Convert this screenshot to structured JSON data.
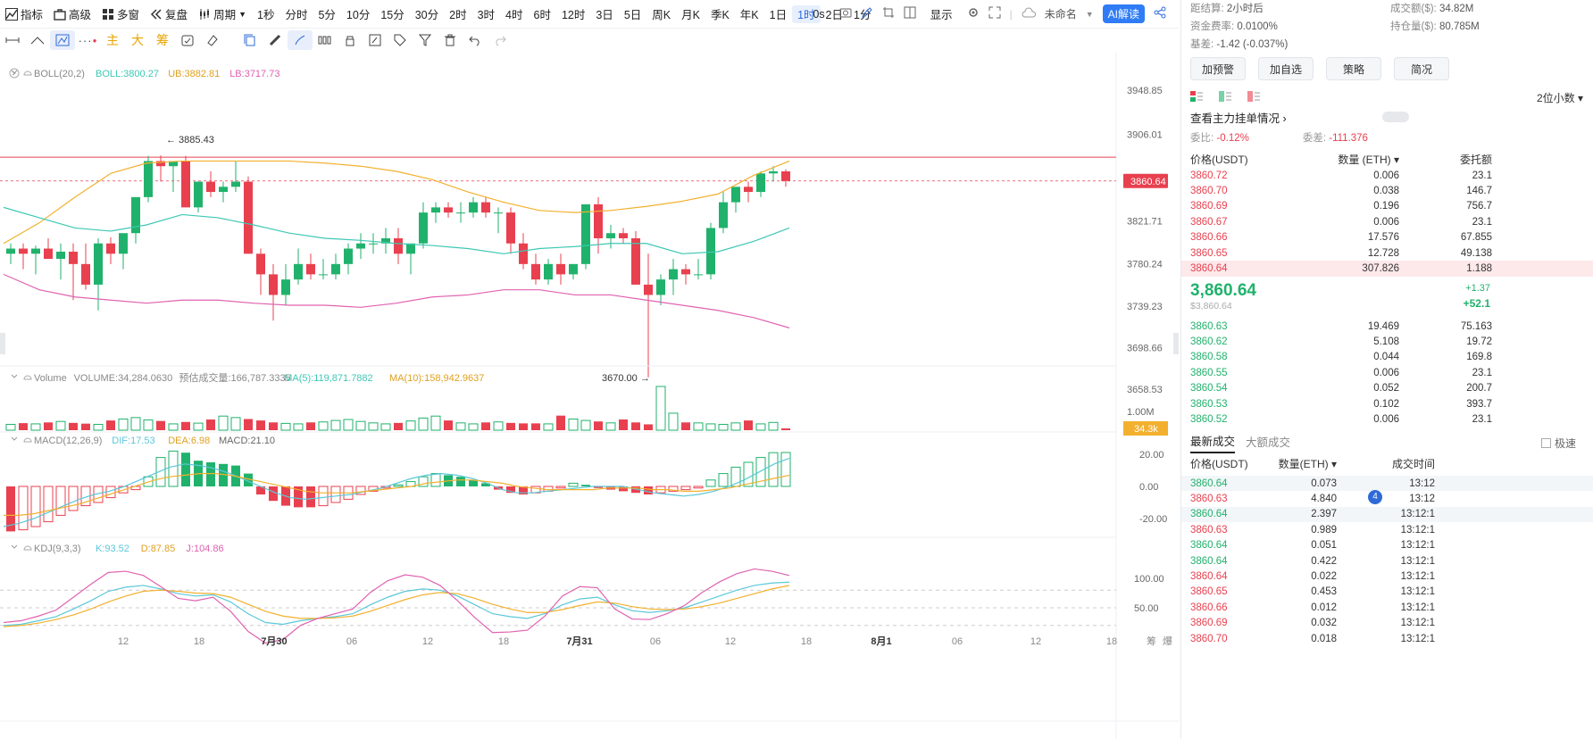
{
  "topbar": {
    "left": [
      "指标",
      "高级",
      "多窗",
      "复盘",
      "周期"
    ],
    "periods": [
      "1秒",
      "分时",
      "5分",
      "10分",
      "15分",
      "30分",
      "2时",
      "3时",
      "4时",
      "6时",
      "12时",
      "3日",
      "5日",
      "周K",
      "月K",
      "季K",
      "年K",
      "1日",
      "1时",
      "2日",
      "1分"
    ],
    "active_period": "1时",
    "right": {
      "countdown": "0s",
      "display": "显示",
      "unnamed": "未命名",
      "ai": "AI解读"
    }
  },
  "toolbar": {
    "text_tools": [
      "主",
      "大",
      "筹"
    ]
  },
  "legends": {
    "boll": {
      "name": "BOLL(20,2)",
      "boll": "BOLL:3800.27",
      "ub": "UB:3882.81",
      "lb": "LB:3717.73"
    },
    "volume": {
      "name": "Volume",
      "vol": "VOLUME:34,284.0630",
      "est": "预估成交量:166,787.3335",
      "ma5": "MA(5):119,871.7882",
      "ma10": "MA(10):158,942.9637"
    },
    "macd": {
      "name": "MACD(12,26,9)",
      "dif": "DIF:17.53",
      "dea": "DEA:6.98",
      "macd": "MACD:21.10"
    },
    "kdj": {
      "name": "KDJ(9,3,3)",
      "k": "K:93.52",
      "d": "D:87.85",
      "j": "J:104.86"
    }
  },
  "price_axis": [
    "3948.85",
    "3906.01",
    "3821.71",
    "3780.24",
    "3739.23",
    "3698.66",
    "3658.53"
  ],
  "current_price_tag": "3860.64",
  "volume_axis": "1.00M",
  "volume_tag": "34.3k",
  "macd_axis": [
    "20.00",
    "0.00",
    "-20.00"
  ],
  "kdj_axis": [
    "100.00",
    "50.00"
  ],
  "time_axis": [
    "12",
    "18",
    "7月30",
    "06",
    "12",
    "18",
    "7月31",
    "06",
    "12",
    "18",
    "8月1",
    "06",
    "12",
    "18"
  ],
  "axis_corner": [
    "筹",
    "爆"
  ],
  "annotations": {
    "high": "3885.43",
    "low": "3670.00"
  },
  "colors": {
    "up": "#20b26c",
    "down": "#e8404f",
    "ub": "#f2b02e",
    "mid": "#3ec8b4",
    "lb": "#e062b0",
    "dif": "#5bc8d8",
    "dea": "#f2b02e",
    "k": "#5bc8d8",
    "d": "#f2b02e",
    "j": "#e062b0"
  },
  "chart_data": {
    "type": "candlestick",
    "interval": "1时",
    "ohlc": [
      [
        3790,
        3800,
        3780,
        3795
      ],
      [
        3795,
        3800,
        3775,
        3790
      ],
      [
        3790,
        3798,
        3770,
        3795
      ],
      [
        3795,
        3805,
        3785,
        3785
      ],
      [
        3785,
        3800,
        3765,
        3792
      ],
      [
        3792,
        3800,
        3745,
        3780
      ],
      [
        3780,
        3800,
        3755,
        3760
      ],
      [
        3760,
        3805,
        3735,
        3800
      ],
      [
        3800,
        3806,
        3780,
        3790
      ],
      [
        3790,
        3808,
        3775,
        3810
      ],
      [
        3810,
        3840,
        3800,
        3845
      ],
      [
        3845,
        3885,
        3840,
        3880
      ],
      [
        3880,
        3885.43,
        3860,
        3875
      ],
      [
        3875,
        3880,
        3850,
        3880
      ],
      [
        3880,
        3885,
        3835,
        3835
      ],
      [
        3835,
        3860,
        3830,
        3860
      ],
      [
        3860,
        3870,
        3845,
        3850
      ],
      [
        3850,
        3860,
        3840,
        3855
      ],
      [
        3855,
        3880,
        3850,
        3860
      ],
      [
        3860,
        3865,
        3790,
        3790
      ],
      [
        3790,
        3795,
        3750,
        3770
      ],
      [
        3770,
        3780,
        3725,
        3750
      ],
      [
        3750,
        3780,
        3740,
        3765
      ],
      [
        3765,
        3795,
        3760,
        3780
      ],
      [
        3780,
        3790,
        3765,
        3770
      ],
      [
        3770,
        3785,
        3765,
        3770
      ],
      [
        3770,
        3790,
        3765,
        3780
      ],
      [
        3780,
        3800,
        3770,
        3795
      ],
      [
        3795,
        3810,
        3785,
        3800
      ],
      [
        3800,
        3810,
        3790,
        3800
      ],
      [
        3800,
        3815,
        3790,
        3805
      ],
      [
        3805,
        3815,
        3780,
        3790
      ],
      [
        3790,
        3800,
        3770,
        3800
      ],
      [
        3800,
        3840,
        3795,
        3830
      ],
      [
        3830,
        3840,
        3820,
        3835
      ],
      [
        3835,
        3840,
        3825,
        3830
      ],
      [
        3830,
        3840,
        3820,
        3830
      ],
      [
        3830,
        3845,
        3825,
        3840
      ],
      [
        3840,
        3845,
        3825,
        3830
      ],
      [
        3830,
        3835,
        3810,
        3830
      ],
      [
        3830,
        3835,
        3790,
        3800
      ],
      [
        3800,
        3810,
        3775,
        3780
      ],
      [
        3780,
        3790,
        3760,
        3765
      ],
      [
        3765,
        3785,
        3760,
        3780
      ],
      [
        3780,
        3790,
        3760,
        3770
      ],
      [
        3770,
        3780,
        3765,
        3780
      ],
      [
        3780,
        3838,
        3775,
        3838
      ],
      [
        3838,
        3845,
        3790,
        3805
      ],
      [
        3805,
        3818,
        3795,
        3810
      ],
      [
        3810,
        3815,
        3800,
        3805
      ],
      [
        3805,
        3812,
        3760,
        3760
      ],
      [
        3760,
        3790,
        3670,
        3750
      ],
      [
        3750,
        3770,
        3740,
        3765
      ],
      [
        3765,
        3785,
        3750,
        3775
      ],
      [
        3775,
        3780,
        3760,
        3770
      ],
      [
        3770,
        3785,
        3765,
        3770
      ],
      [
        3770,
        3820,
        3765,
        3815
      ],
      [
        3815,
        3850,
        3810,
        3840
      ],
      [
        3840,
        3850,
        3830,
        3855
      ],
      [
        3855,
        3860,
        3840,
        3850
      ],
      [
        3850,
        3870,
        3845,
        3868
      ],
      [
        3868,
        3875,
        3860,
        3870
      ],
      [
        3870,
        3872,
        3855,
        3860.64
      ]
    ],
    "boll_ub": [
      3800,
      3820,
      3845,
      3868,
      3878,
      3880,
      3880,
      3880,
      3880,
      3878,
      3875,
      3870,
      3862,
      3850,
      3840,
      3832,
      3830,
      3832,
      3836,
      3841,
      3848,
      3866,
      3880
    ],
    "boll_mid": [
      3835,
      3825,
      3815,
      3812,
      3818,
      3828,
      3825,
      3818,
      3810,
      3805,
      3803,
      3800,
      3798,
      3795,
      3790,
      3795,
      3797,
      3800,
      3800,
      3790,
      3792,
      3802,
      3815
    ],
    "boll_lb": [
      3770,
      3755,
      3748,
      3745,
      3742,
      3745,
      3745,
      3742,
      3740,
      3740,
      3738,
      3742,
      3748,
      3750,
      3755,
      3755,
      3750,
      3750,
      3745,
      3740,
      3735,
      3728,
      3718
    ],
    "volume": [
      120,
      145,
      130,
      160,
      180,
      150,
      135,
      120,
      200,
      230,
      260,
      210,
      190,
      130,
      170,
      145,
      220,
      290,
      260,
      230,
      200,
      160,
      140,
      130,
      160,
      170,
      200,
      220,
      180,
      150,
      130,
      150,
      190,
      250,
      290,
      200,
      150,
      130,
      160,
      170,
      150,
      140,
      140,
      130,
      300,
      230,
      200,
      180,
      150,
      220,
      160,
      120,
      900,
      350,
      160,
      150,
      130,
      120,
      150,
      200,
      130,
      160,
      34.3
    ],
    "macd_hist": [
      -28,
      -27,
      -25,
      -22,
      -18,
      -15,
      -12,
      -10,
      -7,
      -4,
      -2,
      6,
      18,
      22,
      21,
      16,
      15,
      14,
      13,
      8,
      -5,
      -9,
      -12,
      -13,
      -13,
      -12,
      -10,
      -8,
      -5,
      -3,
      -1,
      1,
      3,
      6,
      8,
      7,
      6,
      4,
      2,
      -2,
      -4,
      -5,
      -4,
      -3,
      -1,
      2,
      1,
      -1,
      -2,
      -3,
      -4,
      -5,
      -4,
      -3,
      -2,
      -1,
      4,
      8,
      12,
      15,
      18,
      21,
      21.1
    ],
    "macd_dif": [
      -25,
      -23,
      -20,
      -16,
      -12,
      -8,
      -5,
      -3,
      0,
      4,
      8,
      12,
      14,
      13,
      11,
      8,
      4,
      0,
      -4,
      -7,
      -8,
      -7,
      -6,
      -5,
      -3,
      -1,
      2,
      5,
      7,
      8,
      7,
      5,
      2,
      -2,
      -4,
      -4,
      -3,
      -2,
      -1,
      0,
      0,
      0,
      -2,
      -4,
      -5,
      -6,
      -5,
      -3,
      0,
      4,
      9,
      14,
      17.53
    ],
    "macd_dea": [
      -18,
      -18,
      -17,
      -15,
      -13,
      -11,
      -8,
      -5,
      -2,
      1,
      4,
      6,
      7,
      8,
      8,
      7,
      5,
      3,
      1,
      -1,
      -3,
      -4,
      -4,
      -4,
      -3,
      -2,
      -1,
      0,
      2,
      3,
      4,
      4,
      3,
      2,
      0,
      -1,
      -2,
      -2,
      -2,
      -2,
      -1,
      -1,
      -1,
      -2,
      -2,
      -3,
      -3,
      -2,
      -1,
      1,
      3,
      5,
      6.98
    ],
    "kdj_k": [
      20,
      22,
      28,
      35,
      48,
      62,
      78,
      85,
      88,
      82,
      74,
      70,
      72,
      60,
      40,
      25,
      22,
      28,
      32,
      35,
      40,
      55,
      68,
      78,
      82,
      80,
      70,
      55,
      40,
      35,
      32,
      40,
      55,
      65,
      68,
      55,
      45,
      42,
      45,
      50,
      60,
      70,
      80,
      88,
      92,
      93.52
    ],
    "kdj_d": [
      18,
      20,
      24,
      30,
      38,
      48,
      60,
      70,
      78,
      80,
      78,
      75,
      74,
      68,
      56,
      44,
      36,
      32,
      32,
      33,
      36,
      44,
      54,
      64,
      72,
      76,
      74,
      66,
      56,
      48,
      42,
      42,
      47,
      54,
      60,
      58,
      52,
      48,
      47,
      48,
      52,
      58,
      66,
      74,
      82,
      87.85
    ],
    "kdj_j": [
      25,
      28,
      36,
      46,
      68,
      90,
      110,
      112,
      105,
      86,
      66,
      62,
      68,
      44,
      10,
      -10,
      -4,
      20,
      32,
      40,
      48,
      76,
      96,
      106,
      102,
      88,
      62,
      33,
      8,
      9,
      12,
      36,
      70,
      86,
      84,
      48,
      31,
      30,
      40,
      54,
      76,
      94,
      108,
      116,
      112,
      104.86
    ]
  },
  "right_panel": {
    "info": [
      [
        "距结算:",
        "2小时后"
      ],
      [
        "资金费率:",
        "0.0100%"
      ],
      [
        "基差:",
        "-1.42 (-0.037%)"
      ]
    ],
    "info_right": [
      [
        "成交额($):",
        "34.82M"
      ],
      [
        "持仓量($):",
        "80.785M"
      ]
    ],
    "buttons": [
      "加预警",
      "加自选",
      "策略",
      "简况"
    ],
    "precision": "2位小数",
    "book_title": "查看主力挂单情况",
    "ratio": {
      "label1": "委比:",
      "val1": "-0.12%",
      "label2": "委差:",
      "val2": "-111.376"
    },
    "headers": [
      "价格(USDT)",
      "数量 (ETH)",
      "委托额"
    ],
    "asks": [
      [
        "3860.72",
        "0.006",
        "23.1"
      ],
      [
        "3860.70",
        "0.038",
        "146.7"
      ],
      [
        "3860.69",
        "0.196",
        "756.7"
      ],
      [
        "3860.67",
        "0.006",
        "23.1"
      ],
      [
        "3860.66",
        "17.576",
        "67.855"
      ],
      [
        "3860.65",
        "12.728",
        "49.138"
      ],
      [
        "3860.64",
        "307.826",
        "1.188"
      ]
    ],
    "last": {
      "price": "3,860.64",
      "usd": "$3,860.64",
      "chg1": "+1.37",
      "chg2": "+52.1"
    },
    "bids": [
      [
        "3860.63",
        "19.469",
        "75.163"
      ],
      [
        "3860.62",
        "5.108",
        "19.72"
      ],
      [
        "3860.58",
        "0.044",
        "169.8"
      ],
      [
        "3860.55",
        "0.006",
        "23.1"
      ],
      [
        "3860.54",
        "0.052",
        "200.7"
      ],
      [
        "3860.53",
        "0.102",
        "393.7"
      ],
      [
        "3860.52",
        "0.006",
        "23.1"
      ]
    ],
    "trade_tabs": [
      "最新成交",
      "大额成交"
    ],
    "trade_opt": "极速",
    "trade_headers": [
      "价格(USDT)",
      "数量(ETH)",
      "成交时间"
    ],
    "trades": [
      [
        "3860.64",
        "0.073",
        "13:12",
        "g"
      ],
      [
        "3860.63",
        "4.840",
        "13:12",
        "r"
      ],
      [
        "3860.64",
        "2.397",
        "13:12:1",
        "g"
      ],
      [
        "3860.63",
        "0.989",
        "13:12:1",
        "r"
      ],
      [
        "3860.64",
        "0.051",
        "13:12:1",
        "g"
      ],
      [
        "3860.64",
        "0.422",
        "13:12:1",
        "g"
      ],
      [
        "3860.64",
        "0.022",
        "13:12:1",
        "r"
      ],
      [
        "3860.65",
        "0.453",
        "13:12:1",
        "r"
      ],
      [
        "3860.66",
        "0.012",
        "13:12:1",
        "r"
      ],
      [
        "3860.69",
        "0.032",
        "13:12:1",
        "r"
      ],
      [
        "3860.70",
        "0.018",
        "13:12:1",
        "r"
      ]
    ]
  }
}
